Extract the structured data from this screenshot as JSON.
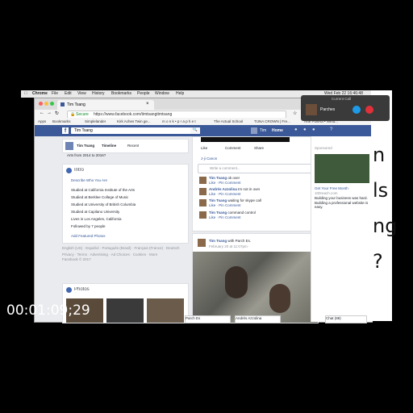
{
  "menubar": {
    "app": "Chrome",
    "items": [
      "File",
      "Edit",
      "View",
      "History",
      "Bookmarks",
      "People",
      "Window",
      "Help"
    ],
    "clock": "Wed Feb 22  16:46:48"
  },
  "call": {
    "title": "Current Call",
    "name": "Parches"
  },
  "browser": {
    "tab_title": "Tim Tsang",
    "secure_label": "Secure",
    "url": "https://www.facebook.com/timtsangtimtsang",
    "bookmarks": [
      "Apps",
      "Bookmarks",
      "Simplelander",
      "Kirk Aches Twin ge...",
      "m o n k • p r a p h e t",
      "The Actual School",
      "TUNA CROWN | Fre...",
      "Arte Povera • Wind..."
    ]
  },
  "fb": {
    "search_value": "Tim Tsang",
    "user_name": "Tim",
    "home_label": "Home",
    "profile_name": "Tim Tsang",
    "timeline_label": "Timeline",
    "recent_label": "Recent",
    "years_text": "Arts from 2014 to 2016?",
    "intro_title": "Intro",
    "describe_link": "Describe Who You Are",
    "intro_items": [
      "Studied at California Institute of the Arts",
      "Studied at Berklee College of Music",
      "Studied at University of British Columbia",
      "Studied at Capilano University",
      "Lives in Los Angeles, California",
      "Followed by 7 people"
    ],
    "featured_link": "Add Featured Photos",
    "languages": "English (US) · Español · Português (Brasil) · Français (France) · Deutsch",
    "footer_links": "Privacy · Terms · Advertising · Ad Choices · Cookies · More",
    "copyright": "Facebook © 2017",
    "photos_title": "Photos",
    "actions": [
      "Like",
      "Comment",
      "Share"
    ],
    "liker": "J-ji Canon",
    "comment_placeholder": "Write a comment...",
    "comments": [
      {
        "author": "Tim Tsang",
        "text": "ok over",
        "meta": "Like · Pin Comment"
      },
      {
        "author": "Tim Tsang",
        "text": "Im not in over",
        "meta": "Like · Pin Comment"
      },
      {
        "author": "Andrés Azzolina",
        "text": "",
        "meta": "Like · Pin Comment"
      },
      {
        "author": "Tim Tsang",
        "text": "waiting for skype call",
        "meta": "Like · Pin Comment"
      },
      {
        "author": "Tim Tsang",
        "text": "command control",
        "meta": "Like · Pin Comment"
      }
    ],
    "post_author": "Tim Tsang",
    "post_with": "with Parch Es.",
    "post_date": "February 20 at 11:07pm ·",
    "sponsored": "Sponsored",
    "ad_title": "Get Your Free Month",
    "ad_domain": "100reach.com",
    "ad_text": "Building your business was hard. Building a professional website is easy.",
    "chat_tabs": [
      "Parch Es",
      "Andrés Azzolina",
      "Chat (88)"
    ]
  },
  "slide": {
    "lines": [
      "n",
      "ls",
      "ng",
      "?"
    ]
  },
  "timecode": "00:01:09;29"
}
